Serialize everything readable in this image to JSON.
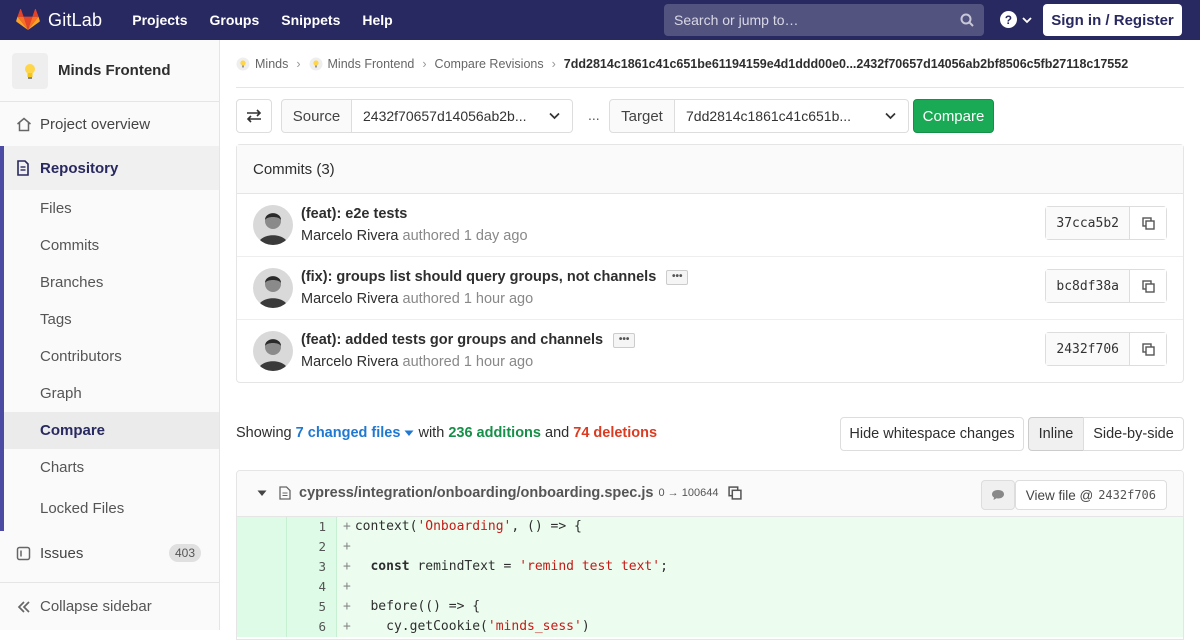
{
  "topnav": {
    "brand": "GitLab",
    "items": [
      "Projects",
      "Groups",
      "Snippets",
      "Help"
    ],
    "search_placeholder": "Search or jump to…",
    "signin": "Sign in / Register"
  },
  "sidebar": {
    "project_name": "Minds Frontend",
    "project_overview": "Project overview",
    "repository": "Repository",
    "repo_items": [
      "Files",
      "Commits",
      "Branches",
      "Tags",
      "Contributors",
      "Graph",
      "Compare",
      "Charts",
      "Locked Files"
    ],
    "active_item": "Compare",
    "issues_label": "Issues",
    "issues_count": "403",
    "collapse": "Collapse sidebar"
  },
  "breadcrumb": {
    "group": "Minds",
    "project": "Minds Frontend",
    "section": "Compare Revisions",
    "current": "7dd2814c1861c41c651be61194159e4d1ddd00e0...2432f70657d14056ab2bf8506c5fb27118c17552"
  },
  "compare": {
    "source_label": "Source",
    "source_value": "2432f70657d14056ab2b...",
    "separator": "...",
    "target_label": "Target",
    "target_value": "7dd2814c1861c41c651b...",
    "compare_button": "Compare"
  },
  "commits": {
    "header": "Commits (3)",
    "items": [
      {
        "title": "(feat): e2e tests",
        "author": "Marcelo Rivera",
        "verb": "authored",
        "time": "1 day ago",
        "sha": "37cca5b2",
        "has_ellipsis": false
      },
      {
        "title": "(fix): groups list should query groups, not channels",
        "author": "Marcelo Rivera",
        "verb": "authored",
        "time": "1 hour ago",
        "sha": "bc8df38a",
        "has_ellipsis": true
      },
      {
        "title": "(feat): added tests gor groups and channels",
        "author": "Marcelo Rivera",
        "verb": "authored",
        "time": "1 hour ago",
        "sha": "2432f706",
        "has_ellipsis": true
      }
    ]
  },
  "changes": {
    "showing": "Showing",
    "files_link": "7 changed files",
    "with": "with",
    "additions": "236 additions",
    "and": "and",
    "deletions": "74 deletions",
    "hide_whitespace": "Hide whitespace changes",
    "inline": "Inline",
    "side_by_side": "Side-by-side"
  },
  "file": {
    "path": "cypress/integration/onboarding/onboarding.spec.js",
    "mode": "0 → 100644",
    "view_file": "View file @",
    "view_sha": "2432f706",
    "lines": [
      {
        "n": "1",
        "code": "context('Onboarding', () => {"
      },
      {
        "n": "2",
        "code": ""
      },
      {
        "n": "3",
        "code": "  const remindText = 'remind test text';"
      },
      {
        "n": "4",
        "code": ""
      },
      {
        "n": "5",
        "code": "  before(() => {"
      },
      {
        "n": "6",
        "code": "    cy.getCookie('minds_sess')"
      }
    ]
  },
  "colors": {
    "topbar": "#292961",
    "compare_button": "#1aaa55",
    "link": "#1f78d1",
    "additions": "#168f48",
    "deletions": "#db3b21"
  }
}
